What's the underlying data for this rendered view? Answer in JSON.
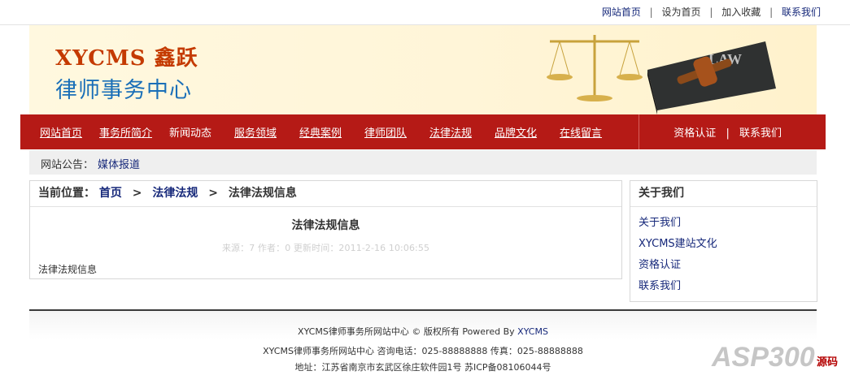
{
  "top_links": [
    "网站首页",
    "设为首页",
    "加入收藏",
    "联系我们"
  ],
  "banner": {
    "logo_line1": "XYCMS 鑫跃",
    "logo_line2": "律师事务中心",
    "book_text": "LAW"
  },
  "nav": {
    "items": [
      "网站首页",
      "事务所简介",
      "新闻动态",
      "服务领域",
      "经典案例",
      "律师团队",
      "法律法规",
      "品牌文化",
      "在线留言"
    ],
    "right": [
      "资格认证",
      "联系我们"
    ]
  },
  "notice": {
    "label": "网站公告：",
    "link": "媒体报道"
  },
  "breadcrumb": {
    "prefix": "当前位置：",
    "home": "首页",
    "section": "法律法规",
    "current": "法律法规信息"
  },
  "article": {
    "title": "法律法规信息",
    "meta": "来源：7 作者：0 更新时间：2011-2-16 10:06:55",
    "body": "法律法规信息"
  },
  "sidebar": {
    "title": "关于我们",
    "links": [
      "关于我们",
      "XYCMS建站文化",
      "资格认证",
      "联系我们"
    ]
  },
  "footer": {
    "line1_prefix": "XYCMS律师事务所网站中心 © 版权所有  Powered By",
    "line1_link": "XYCMS",
    "line2": "XYCMS律师事务所网站中心  咨询电话：025-88888888  传真：025-88888888",
    "line3": "地址：江苏省南京市玄武区徐庄软件园1号   苏ICP备08106044号"
  },
  "watermark": {
    "text": "ASP300",
    "suffix": "源码"
  }
}
